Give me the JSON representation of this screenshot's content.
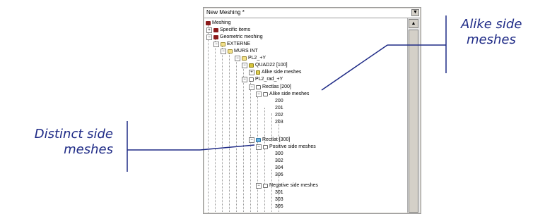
{
  "panel": {
    "title": "New Meshing *",
    "dropdown_glyph": "▼"
  },
  "tree": {
    "root": "Meshing",
    "specific": "Specific items",
    "geometric": "Geometric meshing",
    "externe": "EXTERNE",
    "murs_int": "MURS INT",
    "pl2y": "PL2_+Y",
    "quad22": "QUAD22 [100]",
    "alike1": "Alike side meshes",
    "pl2_rad": "PL2_rad_+Y",
    "rectlas": "Rectlas [200]",
    "alike2": "Alike side meshes",
    "n200": "200",
    "n201": "201",
    "n202": "202",
    "n203": "203",
    "rectlat": "Rectlat [300]",
    "positive": "Positive side meshes",
    "n300": "300",
    "n302": "302",
    "n304": "304",
    "n306": "306",
    "negative": "Negative side meshes",
    "n301": "301",
    "n303": "303",
    "n305": "305"
  },
  "annotations": {
    "alike_line1": "Alike side",
    "alike_line2": "meshes",
    "distinct_line1": "Distinct side",
    "distinct_line2": "meshes"
  },
  "colors": {
    "annotation": "#1e2a86",
    "leader": "#1e2a86"
  }
}
